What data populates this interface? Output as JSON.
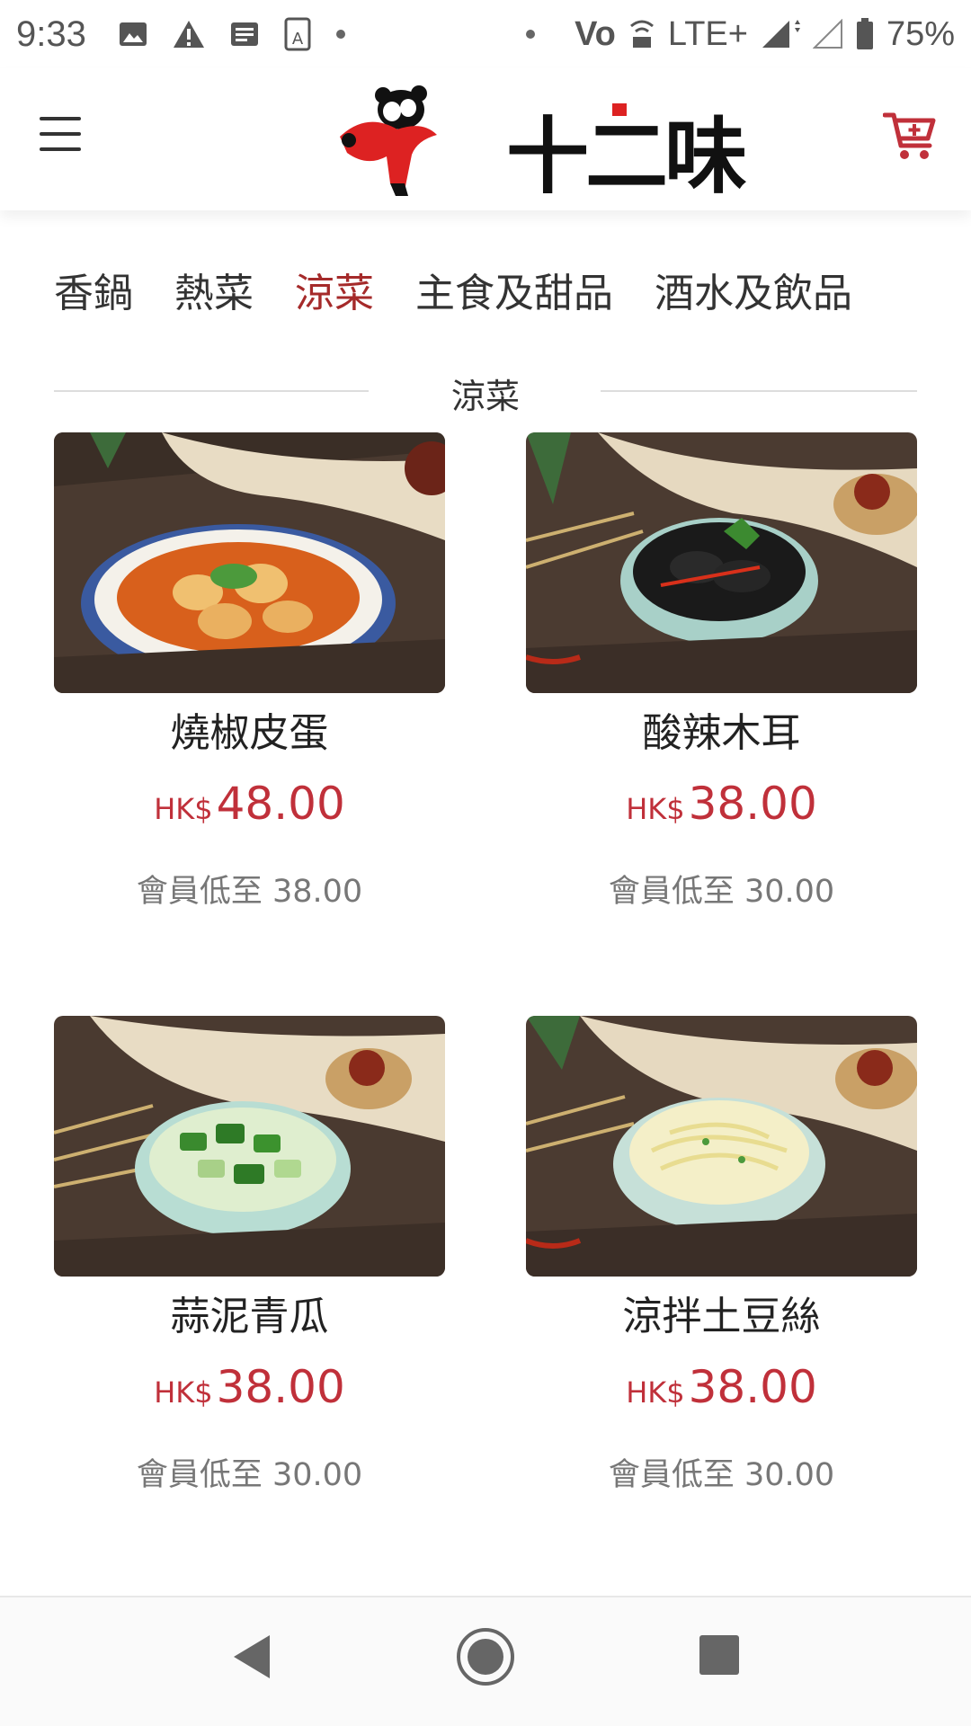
{
  "status_bar": {
    "time": "9:33",
    "network": "LTE+",
    "volte": "Vo",
    "battery": "75%",
    "icons": [
      "image-icon",
      "warning-icon",
      "news-icon",
      "text-icon",
      "signal-icon",
      "battery-icon"
    ]
  },
  "header": {
    "brand_name": "十二味",
    "menu_icon": "menu-icon",
    "cart_icon": "cart-plus-icon",
    "accent_color": "#c0303a"
  },
  "tabs": [
    {
      "label": "香鍋",
      "active": false
    },
    {
      "label": "熱菜",
      "active": false
    },
    {
      "label": "涼菜",
      "active": true
    },
    {
      "label": "主食及甜品",
      "active": false
    },
    {
      "label": "酒水及飲品",
      "active": false
    }
  ],
  "section": {
    "title": "涼菜"
  },
  "products": [
    {
      "name": "燒椒皮蛋",
      "currency": "HK$",
      "price": "48.00",
      "member_price": "會員低至 38.00"
    },
    {
      "name": "酸辣木耳",
      "currency": "HK$",
      "price": "38.00",
      "member_price": "會員低至 30.00"
    },
    {
      "name": "蒜泥青瓜",
      "currency": "HK$",
      "price": "38.00",
      "member_price": "會員低至 30.00"
    },
    {
      "name": "涼拌土豆絲",
      "currency": "HK$",
      "price": "38.00",
      "member_price": "會員低至 30.00"
    }
  ],
  "nav_bar": {
    "icons": [
      "back-icon",
      "home-icon",
      "recents-icon"
    ]
  }
}
